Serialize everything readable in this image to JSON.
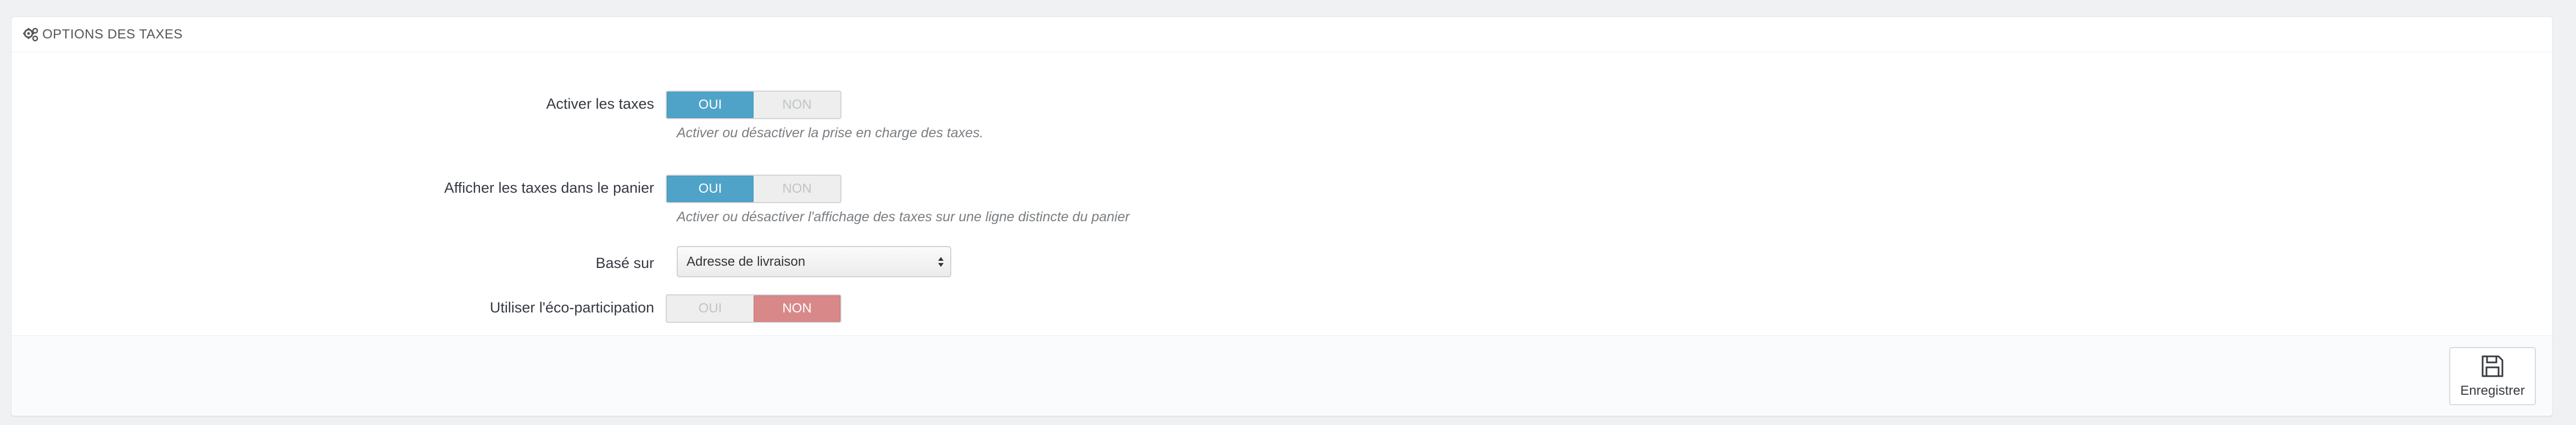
{
  "panel": {
    "title": "OPTIONS DES TAXES",
    "icon": "gears-icon"
  },
  "fields": {
    "enable_taxes": {
      "label": "Activer les taxes",
      "yes_label": "OUI",
      "no_label": "NON",
      "value": "OUI",
      "help": "Activer ou désactiver la prise en charge des taxes."
    },
    "display_tax_in_cart": {
      "label": "Afficher les taxes dans le panier",
      "yes_label": "OUI",
      "no_label": "NON",
      "value": "OUI",
      "help": "Activer ou désactiver l'affichage des taxes sur une ligne distincte du panier"
    },
    "based_on": {
      "label": "Basé sur",
      "selected": "Adresse de livraison"
    },
    "eco_tax": {
      "label": "Utiliser l'éco-participation",
      "yes_label": "OUI",
      "no_label": "NON",
      "value": "NON"
    }
  },
  "footer": {
    "save_label": "Enregistrer",
    "save_icon": "floppy-disk-icon"
  },
  "colors": {
    "switch_yes_active": "#4fa3c9",
    "switch_no_active": "#d9888a",
    "background": "#eff1f2"
  }
}
